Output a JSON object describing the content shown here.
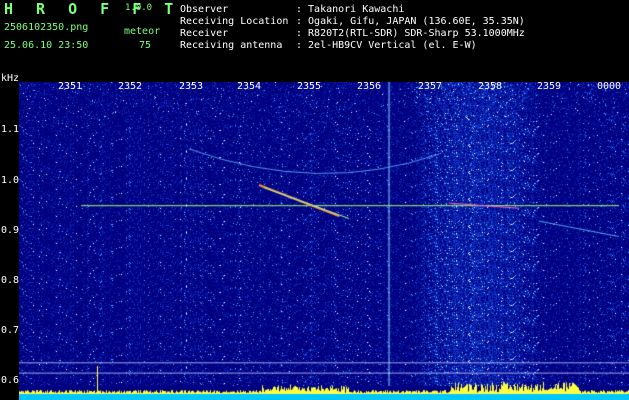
{
  "app": {
    "title": "H R O F F T",
    "version": "1.0.0",
    "filename": "2506102350.png",
    "mode_label": "meteor",
    "datetime": "25.06.10 23:50",
    "meteor_count": "75"
  },
  "info": {
    "rows": [
      {
        "label": "Observer",
        "value": ": Takanori Kawachi"
      },
      {
        "label": "Receiving Location",
        "value": ": Ogaki, Gifu, JAPAN (136.60E, 35.35N)"
      },
      {
        "label": "Receiver",
        "value": ": R820T2(RTL-SDR) SDR-Sharp 53.1000MHz"
      },
      {
        "label": "Receiving antenna",
        "value": ": 2el-HB9CV Vertical (el. E-W)"
      }
    ]
  },
  "axes": {
    "y_unit": "kHz",
    "y_ticks": [
      "1.1",
      "1.0",
      "0.9",
      "0.8",
      "0.7",
      "0.6"
    ],
    "x_ticks": [
      "2351",
      "2352",
      "2353",
      "2354",
      "2355",
      "2356",
      "2357",
      "2358",
      "2359",
      "0000"
    ]
  },
  "colors": {
    "header_text": "#7cff7c",
    "info_text": "#ffffff",
    "background": "#000000",
    "trace": "#a0ff60",
    "spectrum_base": "#000080",
    "power_bar": "#ffff40",
    "power_floor": "#00c8ff"
  },
  "spectrogram": {
    "carrier_freq_khz": 0.93,
    "y_range_khz": [
      0.58,
      1.17
    ],
    "time_range_min": [
      0,
      10
    ],
    "noise_band_min": [
      6.5,
      8.5
    ]
  }
}
